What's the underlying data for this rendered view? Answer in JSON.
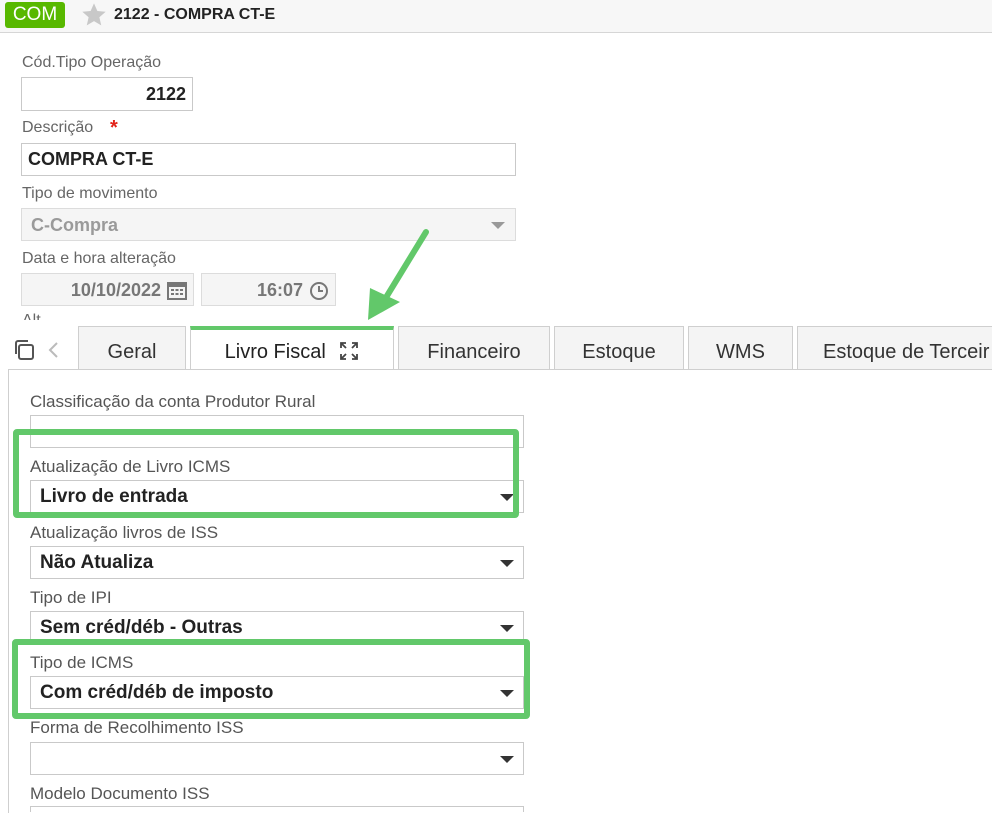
{
  "header": {
    "badge": "COM",
    "title": "2122 - COMPRA CT-E"
  },
  "form": {
    "cod_label": "Cód.Tipo Operação",
    "cod_value": "2122",
    "desc_label": "Descrição",
    "desc_required": "*",
    "desc_value": "COMPRA CT-E",
    "tipo_mov_label": "Tipo de movimento",
    "tipo_mov_value": "C-Compra",
    "data_label": "Data e hora alteração",
    "data_value": "10/10/2022",
    "hora_value": "16:07",
    "cut_label": "Alt"
  },
  "tabs": [
    {
      "label": "Geral"
    },
    {
      "label": "Livro Fiscal"
    },
    {
      "label": "Financeiro"
    },
    {
      "label": "Estoque"
    },
    {
      "label": "WMS"
    },
    {
      "label": "Estoque de Terceir"
    }
  ],
  "panel": {
    "fields": [
      {
        "label": "Classificação da conta Produtor Rural",
        "value": ""
      },
      {
        "label": "Atualização de Livro ICMS",
        "value": "Livro de entrada"
      },
      {
        "label": "Atualização livros de ISS",
        "value": "Não Atualiza"
      },
      {
        "label": "Tipo de IPI",
        "value": "Sem créd/déb - Outras"
      },
      {
        "label": "Tipo de ICMS",
        "value": "Com créd/déb de imposto"
      },
      {
        "label": "Forma de Recolhimento ISS",
        "value": ""
      },
      {
        "label": "Modelo Documento ISS",
        "value": ""
      }
    ]
  },
  "colors": {
    "badge": "#58b800",
    "highlight": "#62c86a",
    "required": "#e2231a"
  }
}
